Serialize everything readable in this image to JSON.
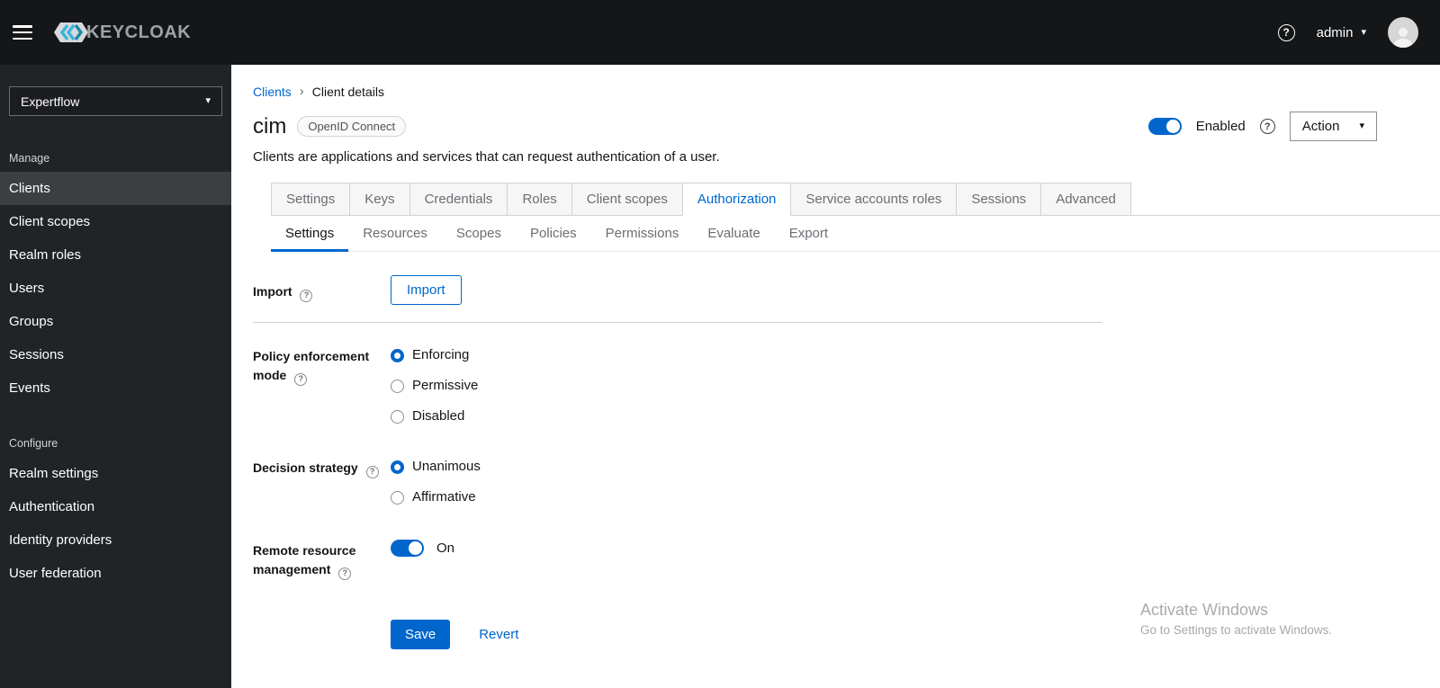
{
  "colors": {
    "primary": "#0066cc",
    "masthead": "#141618",
    "sidebar": "#212427",
    "sidebar-active": "#3c3f42"
  },
  "icons": {
    "caret_down": "▾",
    "breadcrumb_separator": "›",
    "help": "?"
  },
  "header": {
    "brand": "KEYCLOAK",
    "user": "admin"
  },
  "sidebar": {
    "realm": "Expertflow",
    "active_item": "Clients",
    "sections": [
      {
        "label": "Manage",
        "items": [
          "Clients",
          "Client scopes",
          "Realm roles",
          "Users",
          "Groups",
          "Sessions",
          "Events"
        ]
      },
      {
        "label": "Configure",
        "items": [
          "Realm settings",
          "Authentication",
          "Identity providers",
          "User federation"
        ]
      }
    ]
  },
  "breadcrumb": {
    "parent": "Clients",
    "current": "Client details"
  },
  "page": {
    "title": "cim",
    "badge": "OpenID Connect",
    "description": "Clients are applications and services that can request authentication of a user.",
    "enabled_label": "Enabled",
    "action_label": "Action"
  },
  "tabs": {
    "items": [
      "Settings",
      "Keys",
      "Credentials",
      "Roles",
      "Client scopes",
      "Authorization",
      "Service accounts roles",
      "Sessions",
      "Advanced"
    ],
    "active": "Authorization"
  },
  "subtabs": {
    "items": [
      "Settings",
      "Resources",
      "Scopes",
      "Policies",
      "Permissions",
      "Evaluate",
      "Export"
    ],
    "active": "Settings"
  },
  "form": {
    "import": {
      "label": "Import",
      "button_label": "Import"
    },
    "policy_enforcement_mode": {
      "label": "Policy enforcement mode",
      "options": [
        "Enforcing",
        "Permissive",
        "Disabled"
      ],
      "selected": "Enforcing"
    },
    "decision_strategy": {
      "label": "Decision strategy",
      "options": [
        "Unanimous",
        "Affirmative"
      ],
      "selected": "Unanimous"
    },
    "remote_resource_management": {
      "label": "Remote resource management",
      "state": "On"
    },
    "save_label": "Save",
    "revert_label": "Revert"
  },
  "watermark": {
    "line1": "Activate Windows",
    "line2": "Go to Settings to activate Windows."
  }
}
